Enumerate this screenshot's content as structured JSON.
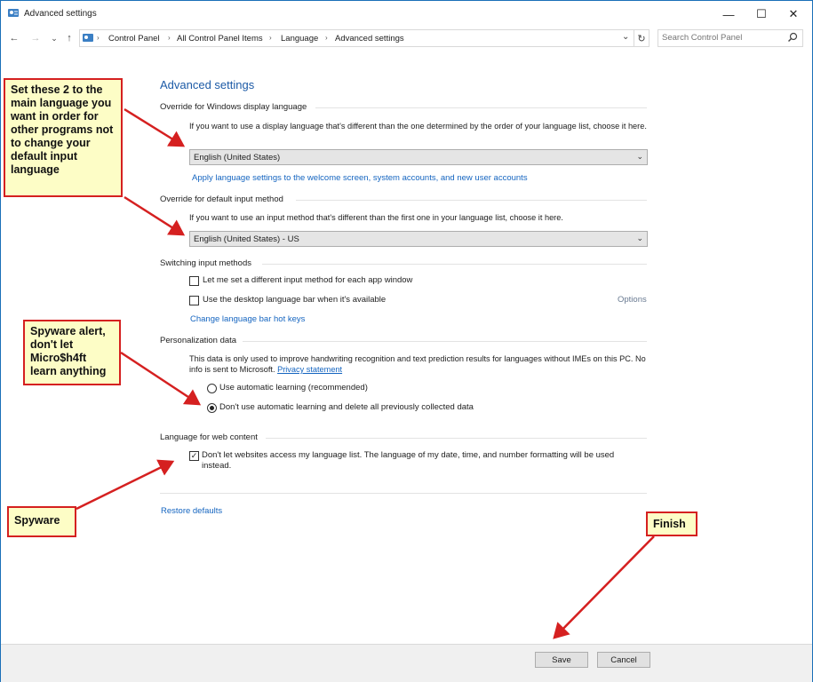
{
  "window": {
    "title": "Advanced settings",
    "minimize_glyph": "—",
    "maximize_glyph": "☐",
    "close_glyph": "✕"
  },
  "nav": {
    "back_glyph": "←",
    "forward_glyph": "→",
    "recent_glyph": "⌄",
    "up_glyph": "↑",
    "breadcrumbs": [
      "Control Panel",
      "All Control Panel Items",
      "Language",
      "Advanced settings"
    ],
    "separator": "›",
    "dropdown_glyph": "⌄",
    "refresh_glyph": "↻",
    "search_placeholder": "Search Control Panel"
  },
  "content": {
    "heading": "Advanced settings",
    "display_language": {
      "section": "Override for Windows display language",
      "description": "If you want to use a display language that's different than the one determined by the order of your language list, choose it here.",
      "selected": "English (United States)",
      "apply_link": "Apply language settings to the welcome screen, system accounts, and new user accounts"
    },
    "input_method": {
      "section": "Override for default input method",
      "description": "If you want to use an input method that's different than the first one in your language list, choose it here.",
      "selected": "English (United States) - US"
    },
    "switching": {
      "section": "Switching input methods",
      "per_app_label": "Let me set a different input method for each app window",
      "per_app_checked": false,
      "language_bar_label": "Use the desktop language bar when it's available",
      "language_bar_checked": false,
      "options_link": "Options",
      "hotkeys_link": "Change language bar hot keys"
    },
    "personalization": {
      "section": "Personalization data",
      "description": "This data is only used to improve handwriting recognition and text prediction results for languages without IMEs on this PC. No info is sent to Microsoft.",
      "privacy_link": "Privacy statement",
      "auto_label": "Use automatic learning (recommended)",
      "no_auto_label": "Don't use automatic learning and delete all previously collected data",
      "selected": "no_auto"
    },
    "web_content": {
      "section": "Language for web content",
      "checkbox_label": "Don't let websites access my language list. The language of my date, time, and number formatting will be used instead.",
      "checked": true,
      "check_glyph": "✓"
    },
    "restore_link": "Restore defaults"
  },
  "footer": {
    "save_label": "Save",
    "cancel_label": "Cancel"
  },
  "annotations": {
    "callout_1": "Set these 2 to the main language you want in order for other programs not to change your default input language",
    "callout_2": "Spyware alert, don't let Micro$h4ft learn anything",
    "callout_3": "Spyware",
    "callout_4": "Finish",
    "arrow_color": "#d52020",
    "callout_fill": "#fdfdc6"
  }
}
